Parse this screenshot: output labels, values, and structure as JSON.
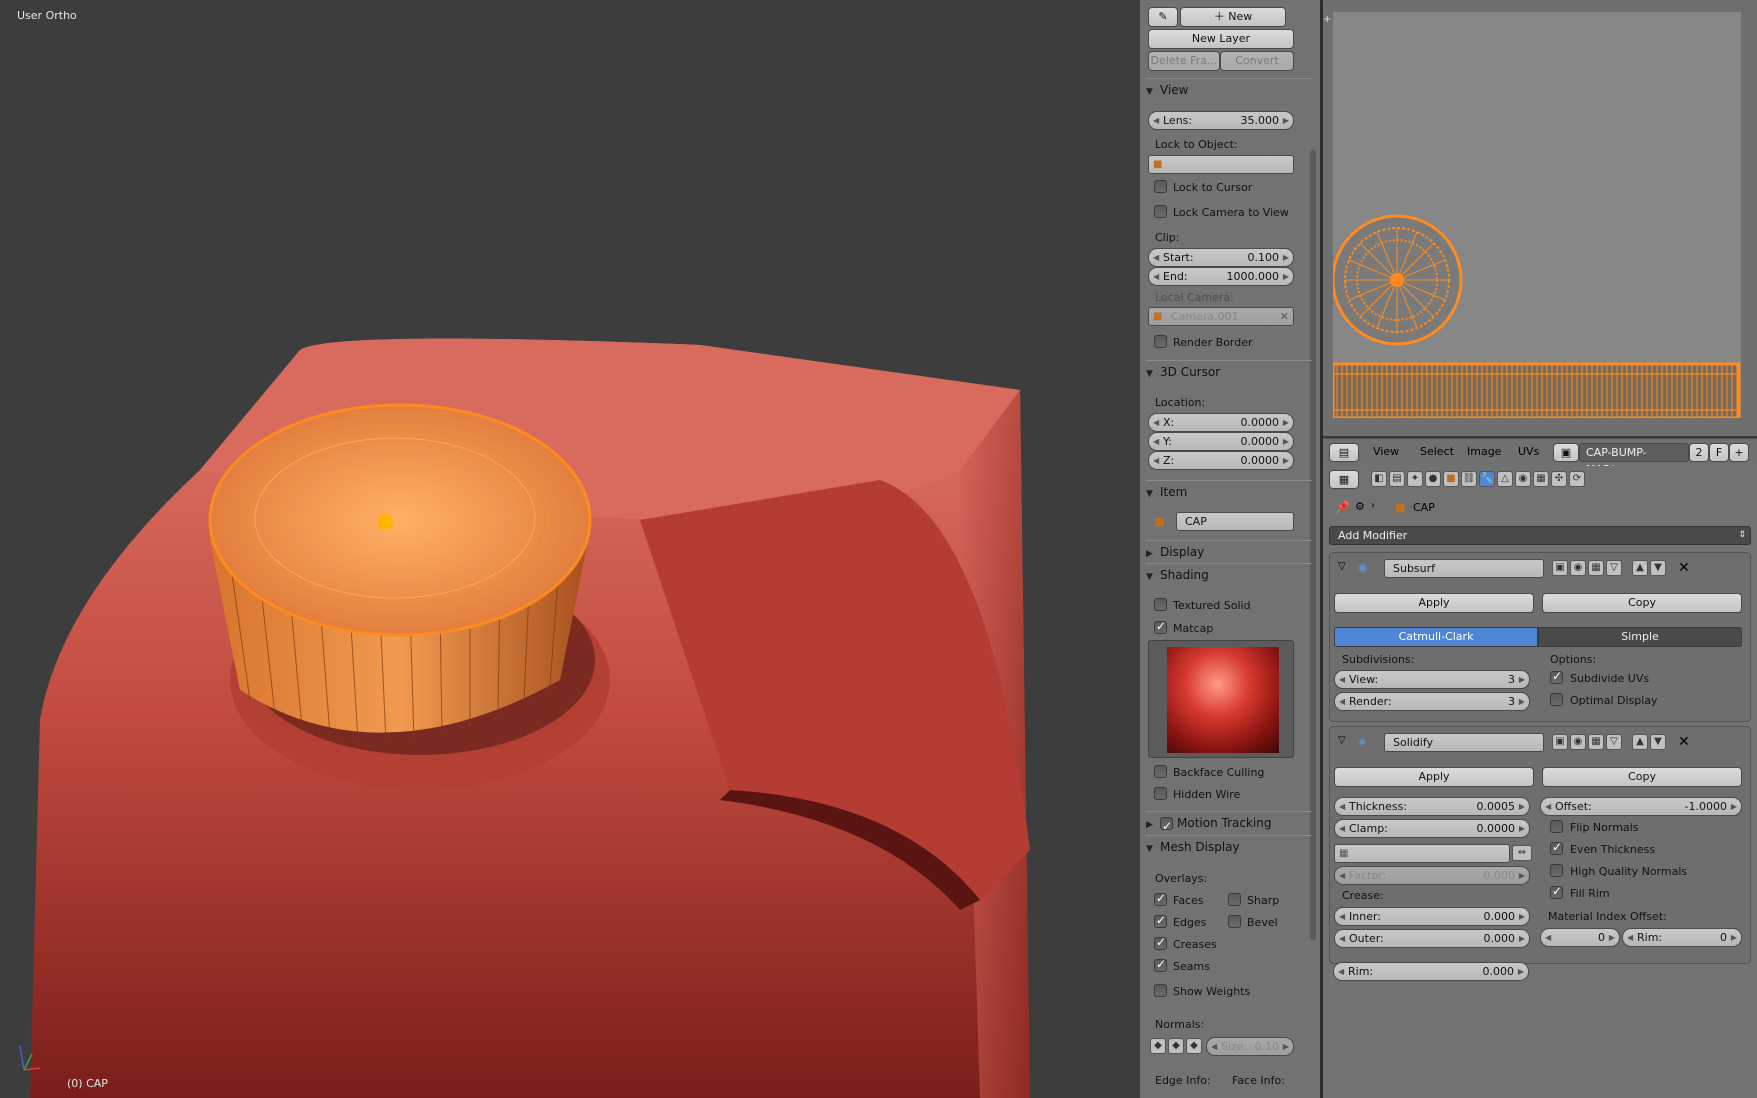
{
  "viewport": {
    "view_label": "User Ortho",
    "object_label": "(0) CAP"
  },
  "npanel": {
    "new_label": "New",
    "new_layer_label": "New Layer",
    "delete_frame_label": "Delete Fra...",
    "convert_label": "Convert",
    "view_header": "View",
    "lens_label": "Lens:",
    "lens_value": "35.000",
    "lock_to_object_label": "Lock to Object:",
    "lock_to_cursor": "Lock to Cursor",
    "lock_camera_to_view": "Lock Camera to View",
    "clip_label": "Clip:",
    "clip_start_label": "Start:",
    "clip_start_value": "0.100",
    "clip_end_label": "End:",
    "clip_end_value": "1000.000",
    "local_camera_label": "Local Camera:",
    "local_camera_value": "Camera.001",
    "render_border": "Render Border",
    "cursor_header": "3D Cursor",
    "location_label": "Location:",
    "x_label": "X:",
    "x_value": "0.0000",
    "y_label": "Y:",
    "y_value": "0.0000",
    "z_label": "Z:",
    "z_value": "0.0000",
    "item_header": "Item",
    "item_name": "CAP",
    "display_header": "Display",
    "shading_header": "Shading",
    "textured_solid": "Textured Solid",
    "matcap": "Matcap",
    "backface_culling": "Backface Culling",
    "hidden_wire": "Hidden Wire",
    "motion_tracking": "Motion Tracking",
    "mesh_display_header": "Mesh Display",
    "overlays_label": "Overlays:",
    "faces": "Faces",
    "sharp": "Sharp",
    "edges": "Edges",
    "bevel": "Bevel",
    "creases": "Creases",
    "seams": "Seams",
    "show_weights": "Show Weights",
    "normals_label": "Normals:",
    "size_label": "Size:",
    "size_value": "0.10",
    "edge_info_label": "Edge Info:",
    "face_info_label": "Face Info:"
  },
  "image_header": {
    "menus": [
      "View",
      "Select",
      "Image",
      "UVs"
    ],
    "image_name": "CAP-BUMP-MAP.jpg",
    "users": "2",
    "fake": "F"
  },
  "properties": {
    "object_name": "CAP",
    "add_modifier": "Add Modifier",
    "subsurf": {
      "name": "Subsurf",
      "apply": "Apply",
      "copy": "Copy",
      "tab_catmull": "Catmull-Clark",
      "tab_simple": "Simple",
      "subdivisions_label": "Subdivisions:",
      "view_label": "View:",
      "view_value": "3",
      "render_label": "Render:",
      "render_value": "3",
      "options_label": "Options:",
      "subdivide_uvs": "Subdivide UVs",
      "optimal_display": "Optimal Display"
    },
    "solidify": {
      "name": "Solidify",
      "apply": "Apply",
      "copy": "Copy",
      "thickness_label": "Thickness:",
      "thickness_value": "0.0005",
      "offset_label": "Offset:",
      "offset_value": "-1.0000",
      "clamp_label": "Clamp:",
      "clamp_value": "0.0000",
      "flip_normals": "Flip Normals",
      "even_thickness": "Even Thickness",
      "high_quality_normals": "High Quality Normals",
      "fill_rim": "Fill Rim",
      "factor_label": "Factor:",
      "factor_value": "0.000",
      "crease_label": "Crease:",
      "inner_label": "Inner:",
      "inner_value": "0.000",
      "outer_label": "Outer:",
      "outer_value": "0.000",
      "rim_label": "Rim:",
      "rim_value": "0.000",
      "material_index_offset_label": "Material Index Offset:",
      "mat_value": "0",
      "mat_rim_label": "Rim:",
      "mat_rim_value": "0"
    }
  },
  "colors": {
    "active_tab": "#4f86d6",
    "object_red": "#c8463c",
    "selection_orange": "#ff8a1f"
  }
}
